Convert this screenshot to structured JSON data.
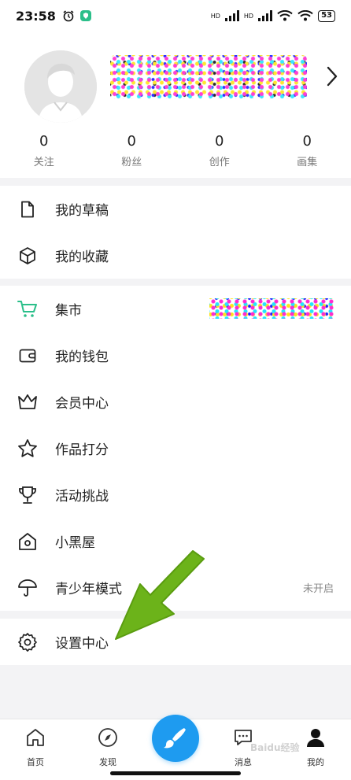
{
  "status_bar": {
    "time": "23:58",
    "signal_label_1": "HD",
    "signal_label_2": "HD",
    "battery": "53"
  },
  "profile": {
    "stats": [
      {
        "value": "0",
        "label": "关注"
      },
      {
        "value": "0",
        "label": "粉丝"
      },
      {
        "value": "0",
        "label": "创作"
      },
      {
        "value": "0",
        "label": "画集"
      }
    ]
  },
  "menu_top": [
    {
      "label": "我的草稿",
      "icon": "draft-icon"
    },
    {
      "label": "我的收藏",
      "icon": "box-icon"
    }
  ],
  "menu_main": [
    {
      "label": "集市",
      "icon": "cart-icon",
      "accent": "#2bbf8a"
    },
    {
      "label": "我的钱包",
      "icon": "wallet-icon"
    },
    {
      "label": "会员中心",
      "icon": "crown-icon"
    },
    {
      "label": "作品打分",
      "icon": "star-icon"
    },
    {
      "label": "活动挑战",
      "icon": "trophy-icon"
    },
    {
      "label": "小黑屋",
      "icon": "house-icon"
    },
    {
      "label": "青少年模式",
      "icon": "umbrella-icon",
      "right_text": "未开启"
    }
  ],
  "menu_settings": [
    {
      "label": "设置中心",
      "icon": "gear-icon"
    }
  ],
  "bottom_nav": [
    {
      "label": "首页",
      "icon": "home-icon"
    },
    {
      "label": "发现",
      "icon": "compass-icon"
    },
    {
      "label": "",
      "icon": "brush-icon"
    },
    {
      "label": "消息",
      "icon": "message-icon"
    },
    {
      "label": "我的",
      "icon": "profile-icon"
    }
  ],
  "watermark": "Baidu经验",
  "colors": {
    "accent_blue": "#1e9bf0",
    "accent_green": "#2bbf8a",
    "annotation_arrow": "#6cb31a"
  }
}
